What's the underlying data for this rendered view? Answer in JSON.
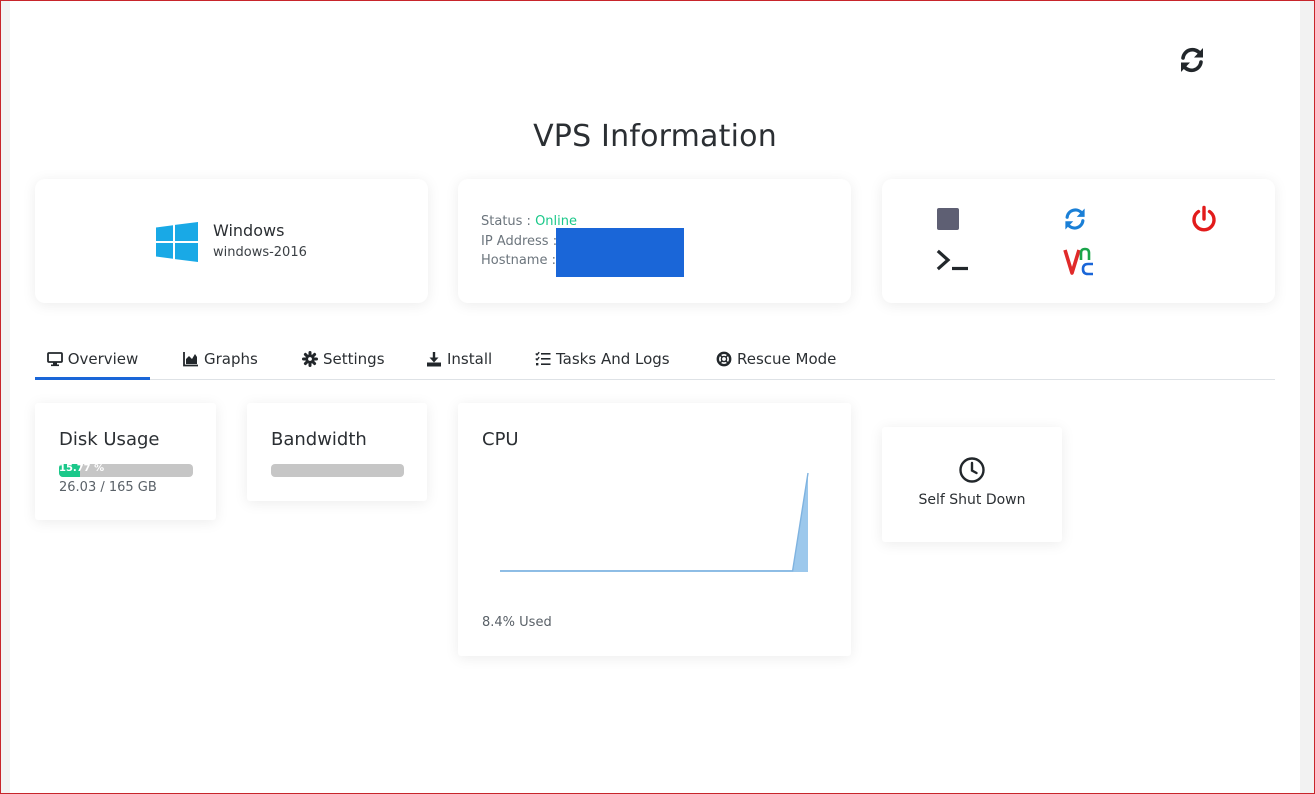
{
  "page": {
    "title": "VPS Information"
  },
  "os": {
    "name": "Windows",
    "version": "windows-2016",
    "icon": "windows-logo-icon"
  },
  "status": {
    "status_label": "Status :",
    "status_value": "Online",
    "ip_label": "IP Address :",
    "hostname_label": "Hostname :"
  },
  "actions": [
    {
      "name": "stop",
      "icon": "stop-icon"
    },
    {
      "name": "restart",
      "icon": "refresh-icon"
    },
    {
      "name": "power",
      "icon": "power-icon"
    },
    {
      "name": "console",
      "icon": "terminal-icon"
    },
    {
      "name": "vnc",
      "icon": "vnc-icon"
    }
  ],
  "tabs": [
    {
      "label": "Overview",
      "icon": "desktop-icon"
    },
    {
      "label": "Graphs",
      "icon": "area-chart-icon"
    },
    {
      "label": "Settings",
      "icon": "gear-icon"
    },
    {
      "label": "Install",
      "icon": "download-icon"
    },
    {
      "label": "Tasks And Logs",
      "icon": "tasks-icon"
    },
    {
      "label": "Rescue Mode",
      "icon": "life-ring-icon"
    }
  ],
  "disk": {
    "title": "Disk Usage",
    "percent_text": "15.77 %",
    "percent": 15.77,
    "usage": "26.03 / 165 GB"
  },
  "bandwidth": {
    "title": "Bandwidth",
    "percent": 0
  },
  "cpu": {
    "title": "CPU",
    "used": "8.4% Used"
  },
  "shutdown": {
    "label": "Self Shut Down",
    "icon": "clock-icon"
  },
  "colors": {
    "accent": "#1a66d8",
    "online": "#1bc88a",
    "power": "#e21b1b",
    "refresh": "#1a7fd6",
    "stop": "#5e5f73"
  },
  "chart_data": {
    "type": "area",
    "title": "CPU",
    "x": [
      0,
      1,
      2,
      3,
      4,
      5,
      6,
      7,
      8,
      9,
      10,
      11,
      12,
      13,
      14,
      15,
      16,
      17,
      18,
      19,
      20
    ],
    "values": [
      0.1,
      0.1,
      0.1,
      0.1,
      0.1,
      0.1,
      0.1,
      0.1,
      0.1,
      0.1,
      0.1,
      0.1,
      0.1,
      0.1,
      0.1,
      0.1,
      0.1,
      0.1,
      0.1,
      0.1,
      8.4
    ],
    "color": "#9cc8ec",
    "grid": false,
    "axes_visible": false
  }
}
